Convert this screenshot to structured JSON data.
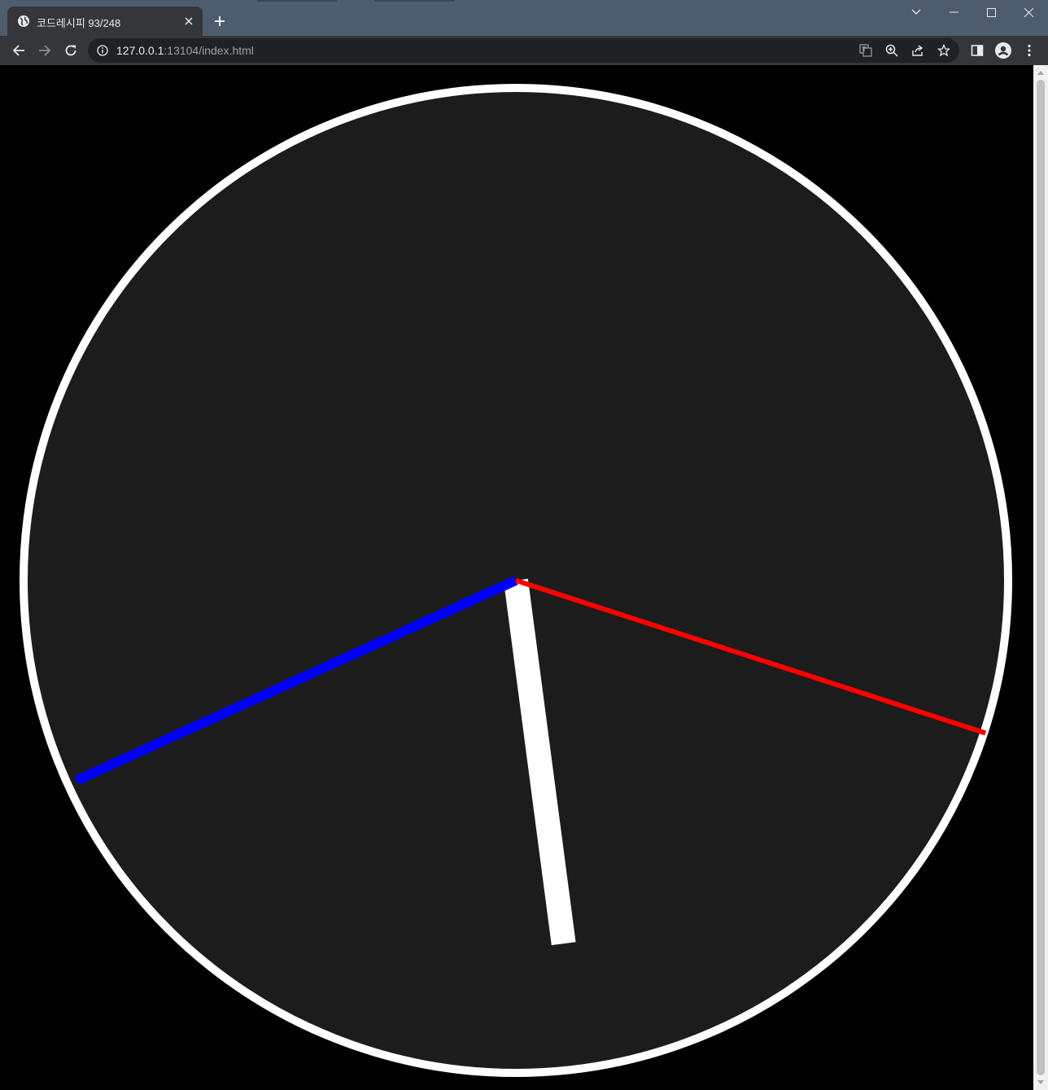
{
  "browser": {
    "tab_title": "코드레시피 93/248",
    "url_host": "127.0.0.1",
    "url_rest": ":13104/index.html"
  },
  "icons": {
    "favicon": "globe-icon",
    "tab_close": "close-icon",
    "new_tab": "plus-icon",
    "back": "arrow-left-icon",
    "forward": "arrow-right-icon",
    "reload": "reload-icon",
    "site_info": "info-icon",
    "translate": "translate-icon",
    "zoom": "zoom-icon",
    "share": "share-icon",
    "bookmark": "star-icon",
    "side_panel": "side-panel-icon",
    "profile": "profile-icon",
    "menu": "kebab-menu-icon"
  },
  "clock": {
    "face_color": "#1c1c1c",
    "rim_color": "#ffffff",
    "background_color": "#000000",
    "hands": [
      {
        "name": "hour",
        "angle_deg": 172.5,
        "color": "#ffffff"
      },
      {
        "name": "minute",
        "angle_deg": 245.5,
        "color": "#0000ff"
      },
      {
        "name": "second",
        "angle_deg": 108,
        "color": "#ff0000"
      }
    ]
  }
}
